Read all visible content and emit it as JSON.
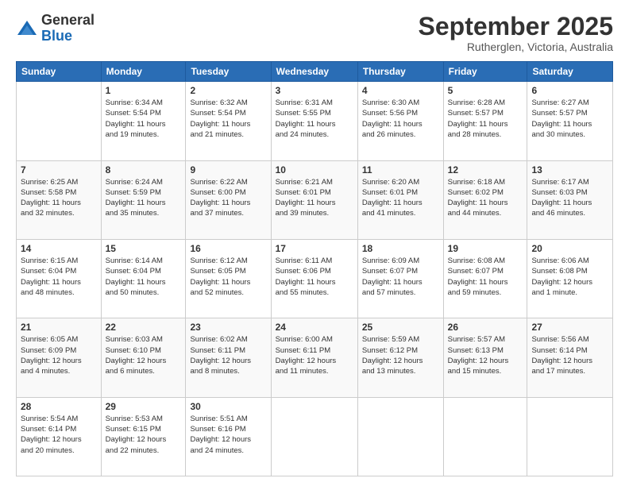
{
  "logo": {
    "general": "General",
    "blue": "Blue"
  },
  "header": {
    "month": "September 2025",
    "location": "Rutherglen, Victoria, Australia"
  },
  "days_of_week": [
    "Sunday",
    "Monday",
    "Tuesday",
    "Wednesday",
    "Thursday",
    "Friday",
    "Saturday"
  ],
  "weeks": [
    [
      {
        "day": "",
        "info": ""
      },
      {
        "day": "1",
        "info": "Sunrise: 6:34 AM\nSunset: 5:54 PM\nDaylight: 11 hours\nand 19 minutes."
      },
      {
        "day": "2",
        "info": "Sunrise: 6:32 AM\nSunset: 5:54 PM\nDaylight: 11 hours\nand 21 minutes."
      },
      {
        "day": "3",
        "info": "Sunrise: 6:31 AM\nSunset: 5:55 PM\nDaylight: 11 hours\nand 24 minutes."
      },
      {
        "day": "4",
        "info": "Sunrise: 6:30 AM\nSunset: 5:56 PM\nDaylight: 11 hours\nand 26 minutes."
      },
      {
        "day": "5",
        "info": "Sunrise: 6:28 AM\nSunset: 5:57 PM\nDaylight: 11 hours\nand 28 minutes."
      },
      {
        "day": "6",
        "info": "Sunrise: 6:27 AM\nSunset: 5:57 PM\nDaylight: 11 hours\nand 30 minutes."
      }
    ],
    [
      {
        "day": "7",
        "info": "Sunrise: 6:25 AM\nSunset: 5:58 PM\nDaylight: 11 hours\nand 32 minutes."
      },
      {
        "day": "8",
        "info": "Sunrise: 6:24 AM\nSunset: 5:59 PM\nDaylight: 11 hours\nand 35 minutes."
      },
      {
        "day": "9",
        "info": "Sunrise: 6:22 AM\nSunset: 6:00 PM\nDaylight: 11 hours\nand 37 minutes."
      },
      {
        "day": "10",
        "info": "Sunrise: 6:21 AM\nSunset: 6:01 PM\nDaylight: 11 hours\nand 39 minutes."
      },
      {
        "day": "11",
        "info": "Sunrise: 6:20 AM\nSunset: 6:01 PM\nDaylight: 11 hours\nand 41 minutes."
      },
      {
        "day": "12",
        "info": "Sunrise: 6:18 AM\nSunset: 6:02 PM\nDaylight: 11 hours\nand 44 minutes."
      },
      {
        "day": "13",
        "info": "Sunrise: 6:17 AM\nSunset: 6:03 PM\nDaylight: 11 hours\nand 46 minutes."
      }
    ],
    [
      {
        "day": "14",
        "info": "Sunrise: 6:15 AM\nSunset: 6:04 PM\nDaylight: 11 hours\nand 48 minutes."
      },
      {
        "day": "15",
        "info": "Sunrise: 6:14 AM\nSunset: 6:04 PM\nDaylight: 11 hours\nand 50 minutes."
      },
      {
        "day": "16",
        "info": "Sunrise: 6:12 AM\nSunset: 6:05 PM\nDaylight: 11 hours\nand 52 minutes."
      },
      {
        "day": "17",
        "info": "Sunrise: 6:11 AM\nSunset: 6:06 PM\nDaylight: 11 hours\nand 55 minutes."
      },
      {
        "day": "18",
        "info": "Sunrise: 6:09 AM\nSunset: 6:07 PM\nDaylight: 11 hours\nand 57 minutes."
      },
      {
        "day": "19",
        "info": "Sunrise: 6:08 AM\nSunset: 6:07 PM\nDaylight: 11 hours\nand 59 minutes."
      },
      {
        "day": "20",
        "info": "Sunrise: 6:06 AM\nSunset: 6:08 PM\nDaylight: 12 hours\nand 1 minute."
      }
    ],
    [
      {
        "day": "21",
        "info": "Sunrise: 6:05 AM\nSunset: 6:09 PM\nDaylight: 12 hours\nand 4 minutes."
      },
      {
        "day": "22",
        "info": "Sunrise: 6:03 AM\nSunset: 6:10 PM\nDaylight: 12 hours\nand 6 minutes."
      },
      {
        "day": "23",
        "info": "Sunrise: 6:02 AM\nSunset: 6:11 PM\nDaylight: 12 hours\nand 8 minutes."
      },
      {
        "day": "24",
        "info": "Sunrise: 6:00 AM\nSunset: 6:11 PM\nDaylight: 12 hours\nand 11 minutes."
      },
      {
        "day": "25",
        "info": "Sunrise: 5:59 AM\nSunset: 6:12 PM\nDaylight: 12 hours\nand 13 minutes."
      },
      {
        "day": "26",
        "info": "Sunrise: 5:57 AM\nSunset: 6:13 PM\nDaylight: 12 hours\nand 15 minutes."
      },
      {
        "day": "27",
        "info": "Sunrise: 5:56 AM\nSunset: 6:14 PM\nDaylight: 12 hours\nand 17 minutes."
      }
    ],
    [
      {
        "day": "28",
        "info": "Sunrise: 5:54 AM\nSunset: 6:14 PM\nDaylight: 12 hours\nand 20 minutes."
      },
      {
        "day": "29",
        "info": "Sunrise: 5:53 AM\nSunset: 6:15 PM\nDaylight: 12 hours\nand 22 minutes."
      },
      {
        "day": "30",
        "info": "Sunrise: 5:51 AM\nSunset: 6:16 PM\nDaylight: 12 hours\nand 24 minutes."
      },
      {
        "day": "",
        "info": ""
      },
      {
        "day": "",
        "info": ""
      },
      {
        "day": "",
        "info": ""
      },
      {
        "day": "",
        "info": ""
      }
    ]
  ]
}
